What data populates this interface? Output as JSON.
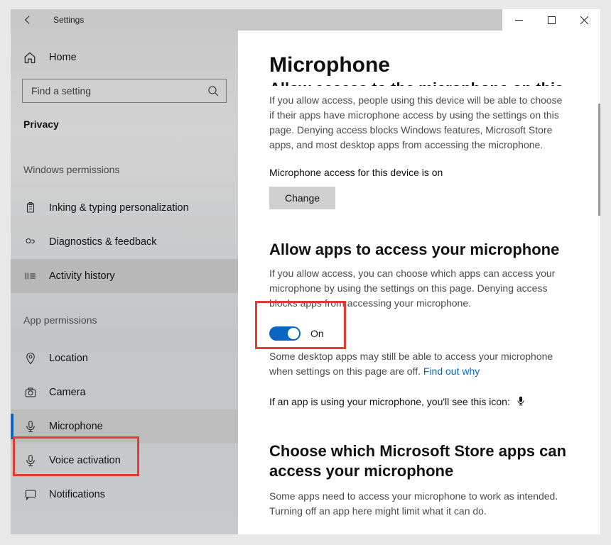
{
  "app": {
    "title": "Settings"
  },
  "home_label": "Home",
  "search": {
    "placeholder": "Find a setting"
  },
  "privacy_label": "Privacy",
  "section_windows_permissions": "Windows permissions",
  "section_app_permissions": "App permissions",
  "nav": {
    "inking": "Inking & typing personalization",
    "diagnostics": "Diagnostics & feedback",
    "activity": "Activity history",
    "location": "Location",
    "camera": "Camera",
    "microphone": "Microphone",
    "voice": "Voice activation",
    "notifications": "Notifications"
  },
  "page": {
    "title": "Microphone",
    "cutoff_heading": "Allow access to the microphone on this device",
    "access_desc": "If you allow access, people using this device will be able to choose if their apps have microphone access by using the settings on this page. Denying access blocks Windows features, Microsoft Store apps, and most desktop apps from accessing the microphone.",
    "access_status": "Microphone access for this device is on",
    "change_label": "Change",
    "allow_apps_heading": "Allow apps to access your microphone",
    "allow_apps_desc": "If you allow access, you can choose which apps can access your microphone by using the settings on this page. Denying access blocks apps from accessing your microphone.",
    "toggle_state": "On",
    "desktop_note_pre": "Some desktop apps may still be able to access your microphone when settings on this page are off. ",
    "desktop_note_link": "Find out why",
    "usage_note": "If an app is using your microphone, you'll see this icon:",
    "store_heading": "Choose which Microsoft Store apps can access your microphone",
    "store_desc": "Some apps need to access your microphone to work as intended. Turning off an app here might limit what it can do."
  }
}
